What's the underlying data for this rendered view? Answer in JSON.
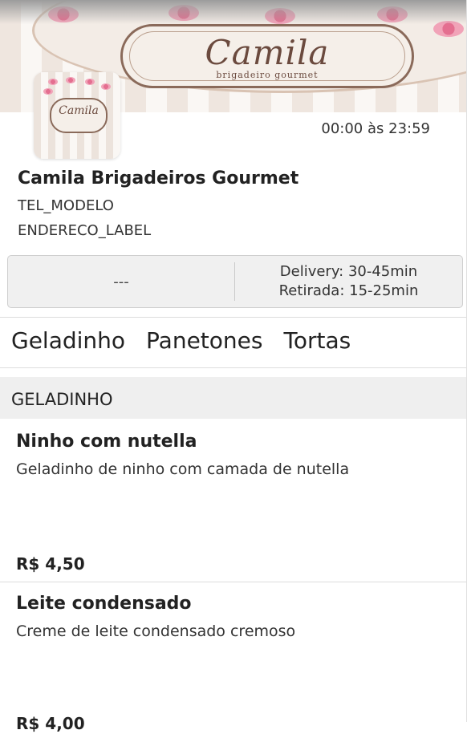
{
  "store": {
    "banner_script": "Camila",
    "banner_sub": "brigadeiro gourmet",
    "logo_text": "Camila",
    "hours": "00:00 às 23:59",
    "name": "Camila Brigadeiros Gourmet",
    "tel": "TEL_MODELO",
    "address": "ENDERECO_LABEL"
  },
  "info": {
    "left": "---",
    "delivery": "Delivery: 30-45min",
    "pickup": "Retirada: 15-25min"
  },
  "tabs": [
    "Geladinho",
    "Panetones",
    "Tortas"
  ],
  "section": {
    "title": "GELADINHO",
    "products": [
      {
        "name": "Ninho com nutella",
        "description": "Geladinho de ninho com camada de nutella",
        "price": "R$ 4,50"
      },
      {
        "name": "Leite condensado",
        "description": "Creme de leite condensado cremoso",
        "price": "R$ 4,00"
      }
    ]
  },
  "colors": {
    "accent_pink": "#e46f90",
    "brown": "#6b4a3e"
  },
  "icons": []
}
